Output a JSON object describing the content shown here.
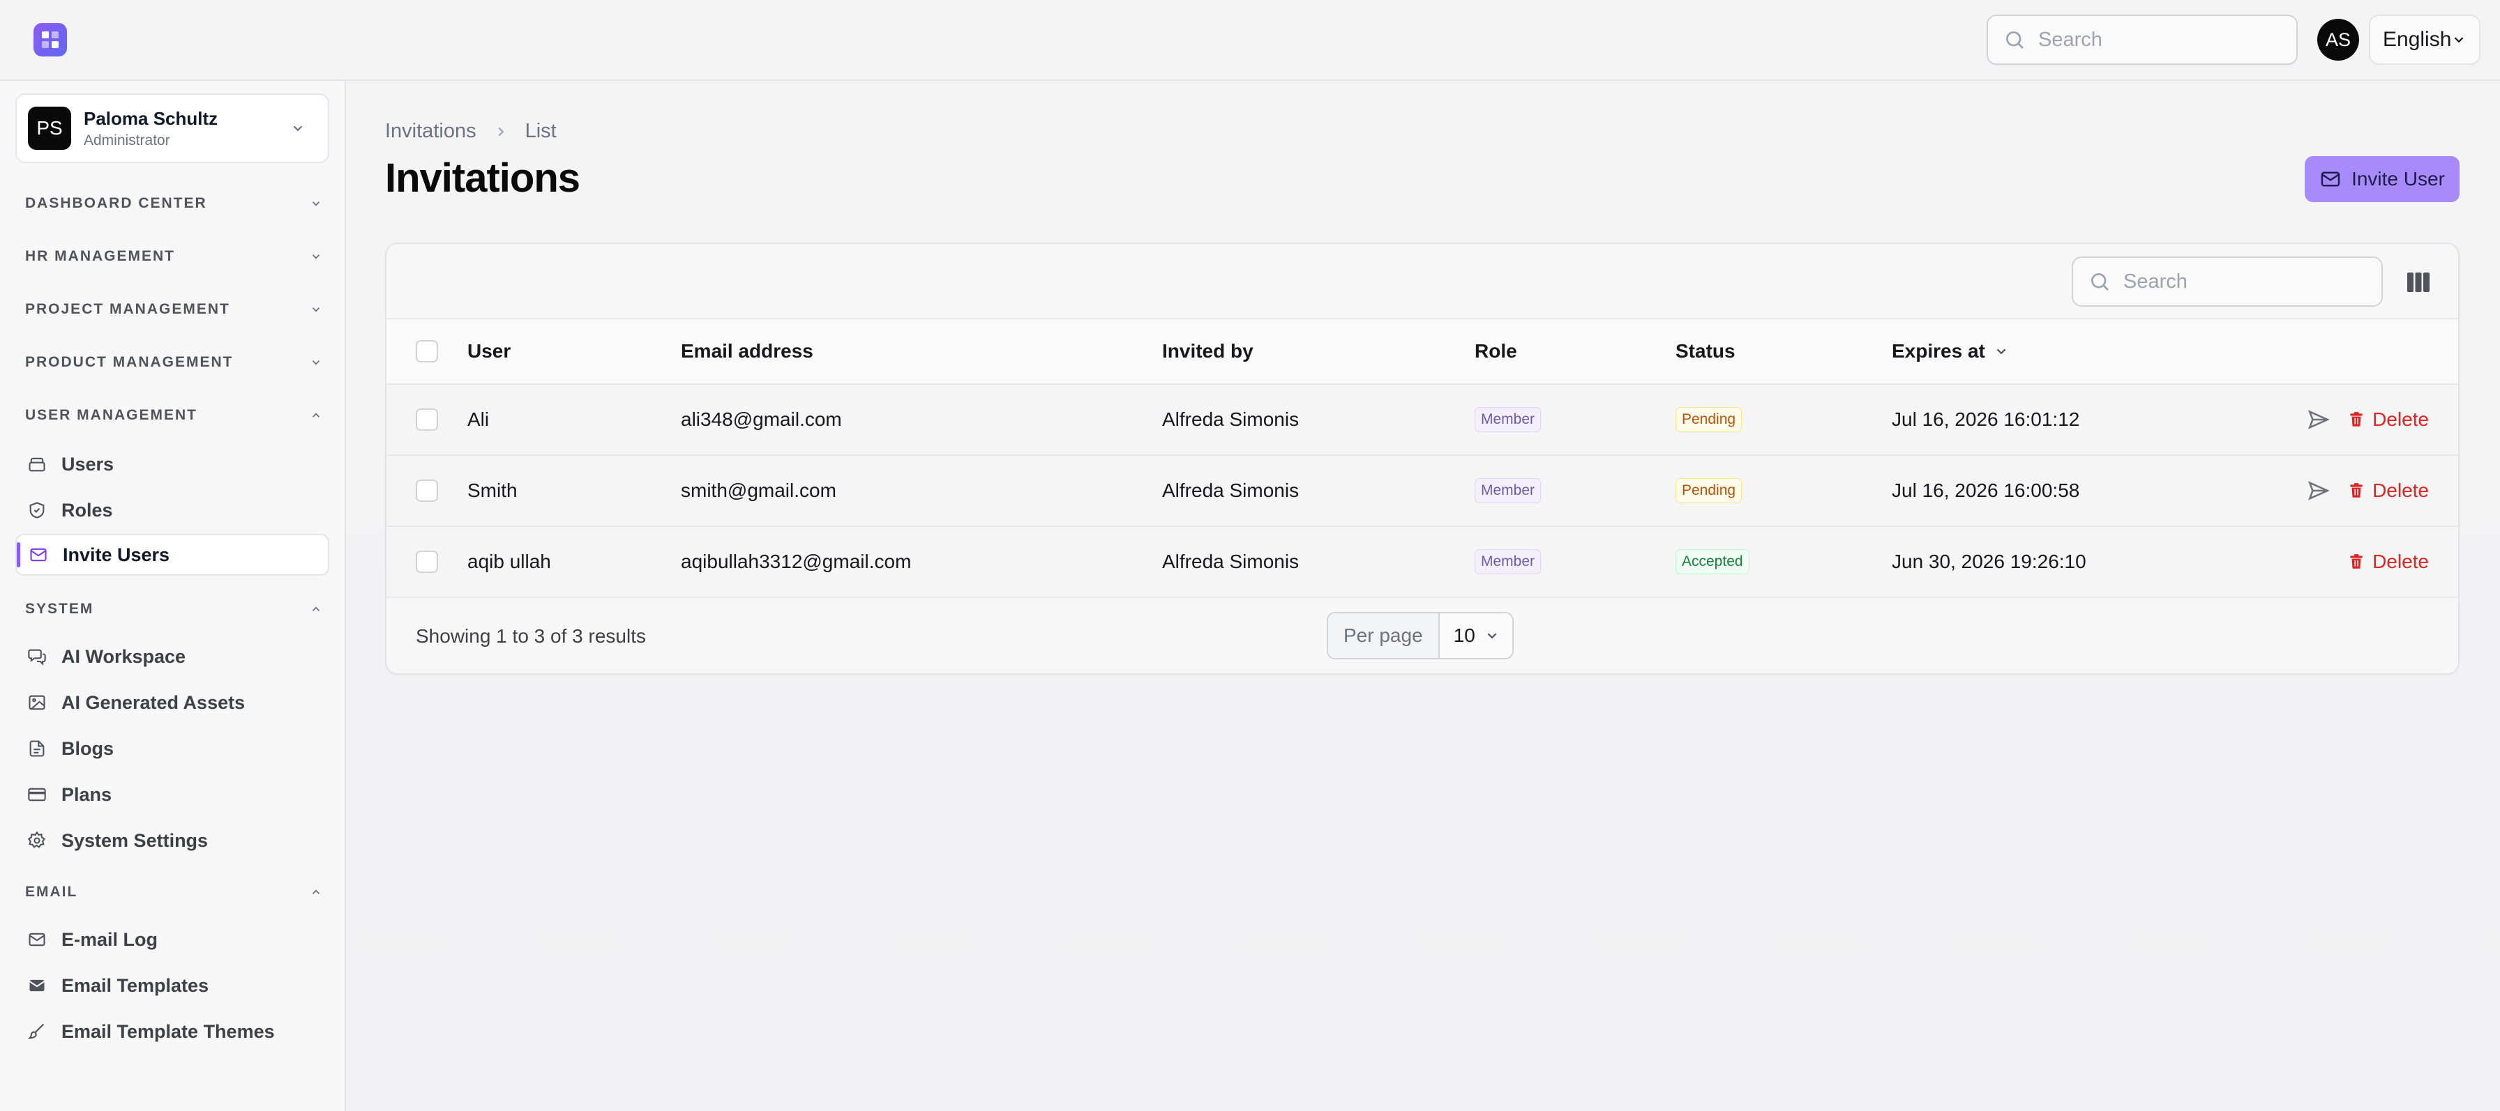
{
  "topbar": {
    "search_placeholder": "Search",
    "avatar_initials": "AS",
    "language": "English"
  },
  "sidebar": {
    "user": {
      "initials": "PS",
      "name": "Paloma Schultz",
      "role": "Administrator"
    },
    "groups": [
      {
        "label": "DASHBOARD CENTER",
        "expanded": false
      },
      {
        "label": "HR MANAGEMENT",
        "expanded": false
      },
      {
        "label": "PROJECT MANAGEMENT",
        "expanded": false
      },
      {
        "label": "PRODUCT MANAGEMENT",
        "expanded": false
      },
      {
        "label": "USER MANAGEMENT",
        "expanded": true
      },
      {
        "label": "SYSTEM",
        "expanded": true
      },
      {
        "label": "EMAIL",
        "expanded": true
      }
    ],
    "user_management_items": [
      {
        "label": "Users",
        "icon": "users-stack-icon"
      },
      {
        "label": "Roles",
        "icon": "shield-icon"
      },
      {
        "label": "Invite Users",
        "icon": "envelope-icon",
        "active": true
      }
    ],
    "system_items": [
      {
        "label": "AI Workspace",
        "icon": "chat-bubbles-icon"
      },
      {
        "label": "AI Generated Assets",
        "icon": "image-icon"
      },
      {
        "label": "Blogs",
        "icon": "document-icon"
      },
      {
        "label": "Plans",
        "icon": "credit-card-icon"
      },
      {
        "label": "System Settings",
        "icon": "gear-icon"
      }
    ],
    "email_items": [
      {
        "label": "E-mail Log",
        "icon": "envelope-icon"
      },
      {
        "label": "Email Templates",
        "icon": "envelope-filled-icon"
      },
      {
        "label": "Email Template Themes",
        "icon": "paintbrush-icon"
      }
    ]
  },
  "main": {
    "breadcrumb": [
      "Invitations",
      "List"
    ],
    "title": "Invitations",
    "invite_button": "Invite User",
    "table_search_placeholder": "Search",
    "columns": [
      "User",
      "Email address",
      "Invited by",
      "Role",
      "Status",
      "Expires at"
    ],
    "rows": [
      {
        "user": "Ali",
        "email": "ali348@gmail.com",
        "invited_by": "Alfreda Simonis",
        "role": "Member",
        "status": "Pending",
        "expires": "Jul 16, 2026 16:01:12",
        "resend": true,
        "delete": "Delete"
      },
      {
        "user": "Smith",
        "email": "smith@gmail.com",
        "invited_by": "Alfreda Simonis",
        "role": "Member",
        "status": "Pending",
        "expires": "Jul 16, 2026 16:00:58",
        "resend": true,
        "delete": "Delete"
      },
      {
        "user": "aqib ullah",
        "email": "aqibullah3312@gmail.com",
        "invited_by": "Alfreda Simonis",
        "role": "Member",
        "status": "Accepted",
        "expires": "Jun 30, 2026 19:26:10",
        "resend": false,
        "delete": "Delete"
      }
    ],
    "showing_text": "Showing 1 to 3 of 3 results",
    "per_page_label": "Per page",
    "per_page_value": "10"
  },
  "colors": {
    "accent": "#a78bfa",
    "danger": "#dc2626",
    "pending": "#b45309",
    "accepted": "#15803d"
  }
}
